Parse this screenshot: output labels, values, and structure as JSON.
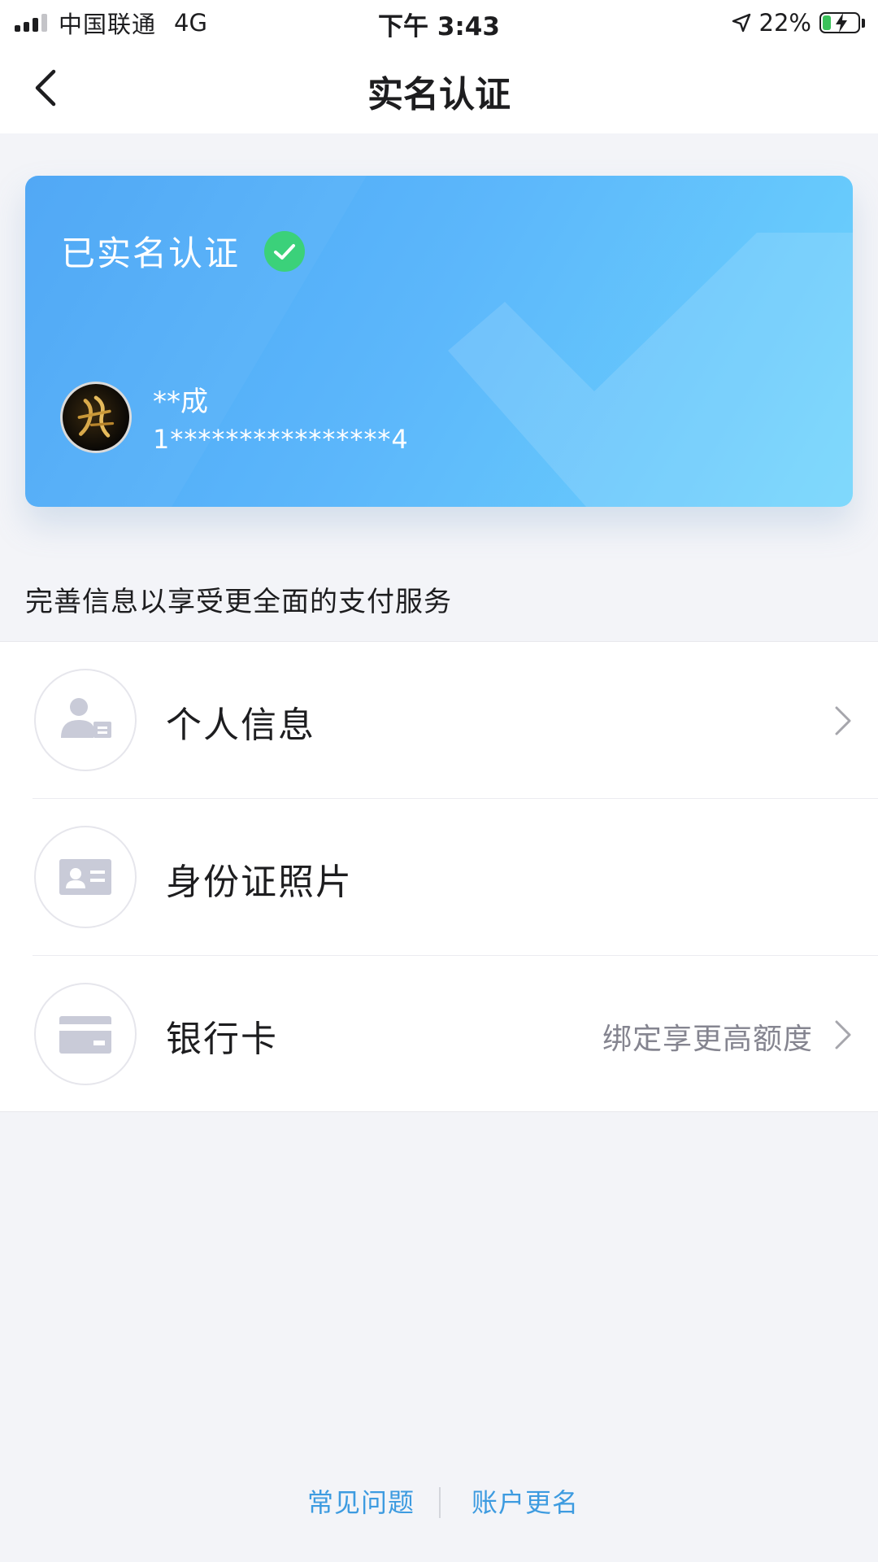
{
  "status_bar": {
    "carrier": "中国联通",
    "network": "4G",
    "time": "下午 3:43",
    "battery_percent": "22%"
  },
  "nav": {
    "title": "实名认证",
    "back_icon": "chevron-left-icon"
  },
  "card": {
    "status_text": "已实名认证",
    "user_name": "**成",
    "user_id": "1****************4",
    "colors": {
      "gradient_start": "#4aa5f5",
      "gradient_end": "#6dd4fc",
      "check_badge": "#3bd17a"
    }
  },
  "info_text": "完善信息以享受更全面的支付服务",
  "items": [
    {
      "label": "个人信息",
      "icon": "person-card-icon",
      "hint": "",
      "has_chevron": true
    },
    {
      "label": "身份证照片",
      "icon": "id-card-icon",
      "hint": "",
      "has_chevron": false
    },
    {
      "label": "银行卡",
      "icon": "bank-card-icon",
      "hint": "绑定享更高额度",
      "has_chevron": true
    }
  ],
  "footer": {
    "faq": "常见问题",
    "rename": "账户更名"
  }
}
